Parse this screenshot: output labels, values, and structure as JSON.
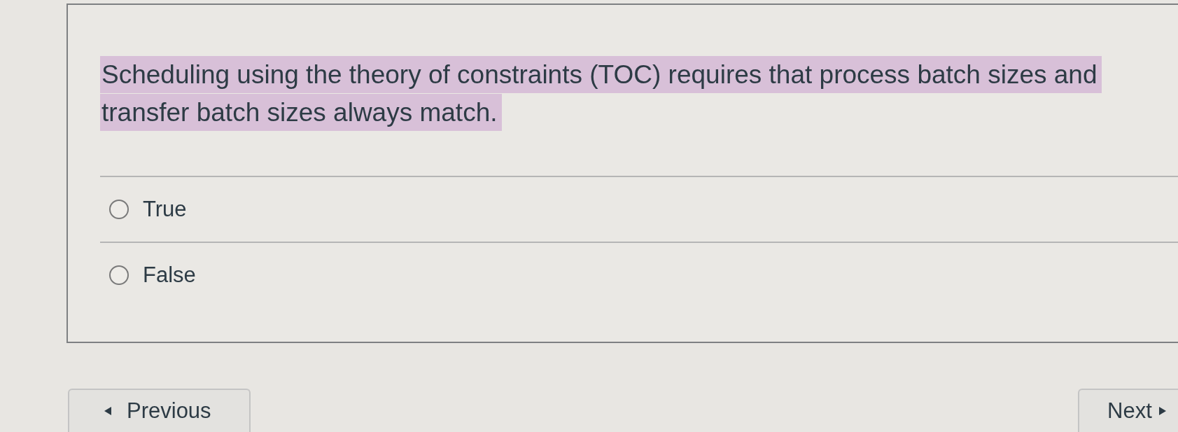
{
  "question": {
    "text": "Scheduling using the theory of constraints (TOC) requires that process batch sizes and transfer batch sizes always match.",
    "highlighted": true
  },
  "options": [
    {
      "label": "True",
      "selected": false
    },
    {
      "label": "False",
      "selected": false
    }
  ],
  "navigation": [
    {
      "label": "Previous",
      "kind": "previous"
    },
    {
      "label": "Next",
      "kind": "next"
    }
  ]
}
